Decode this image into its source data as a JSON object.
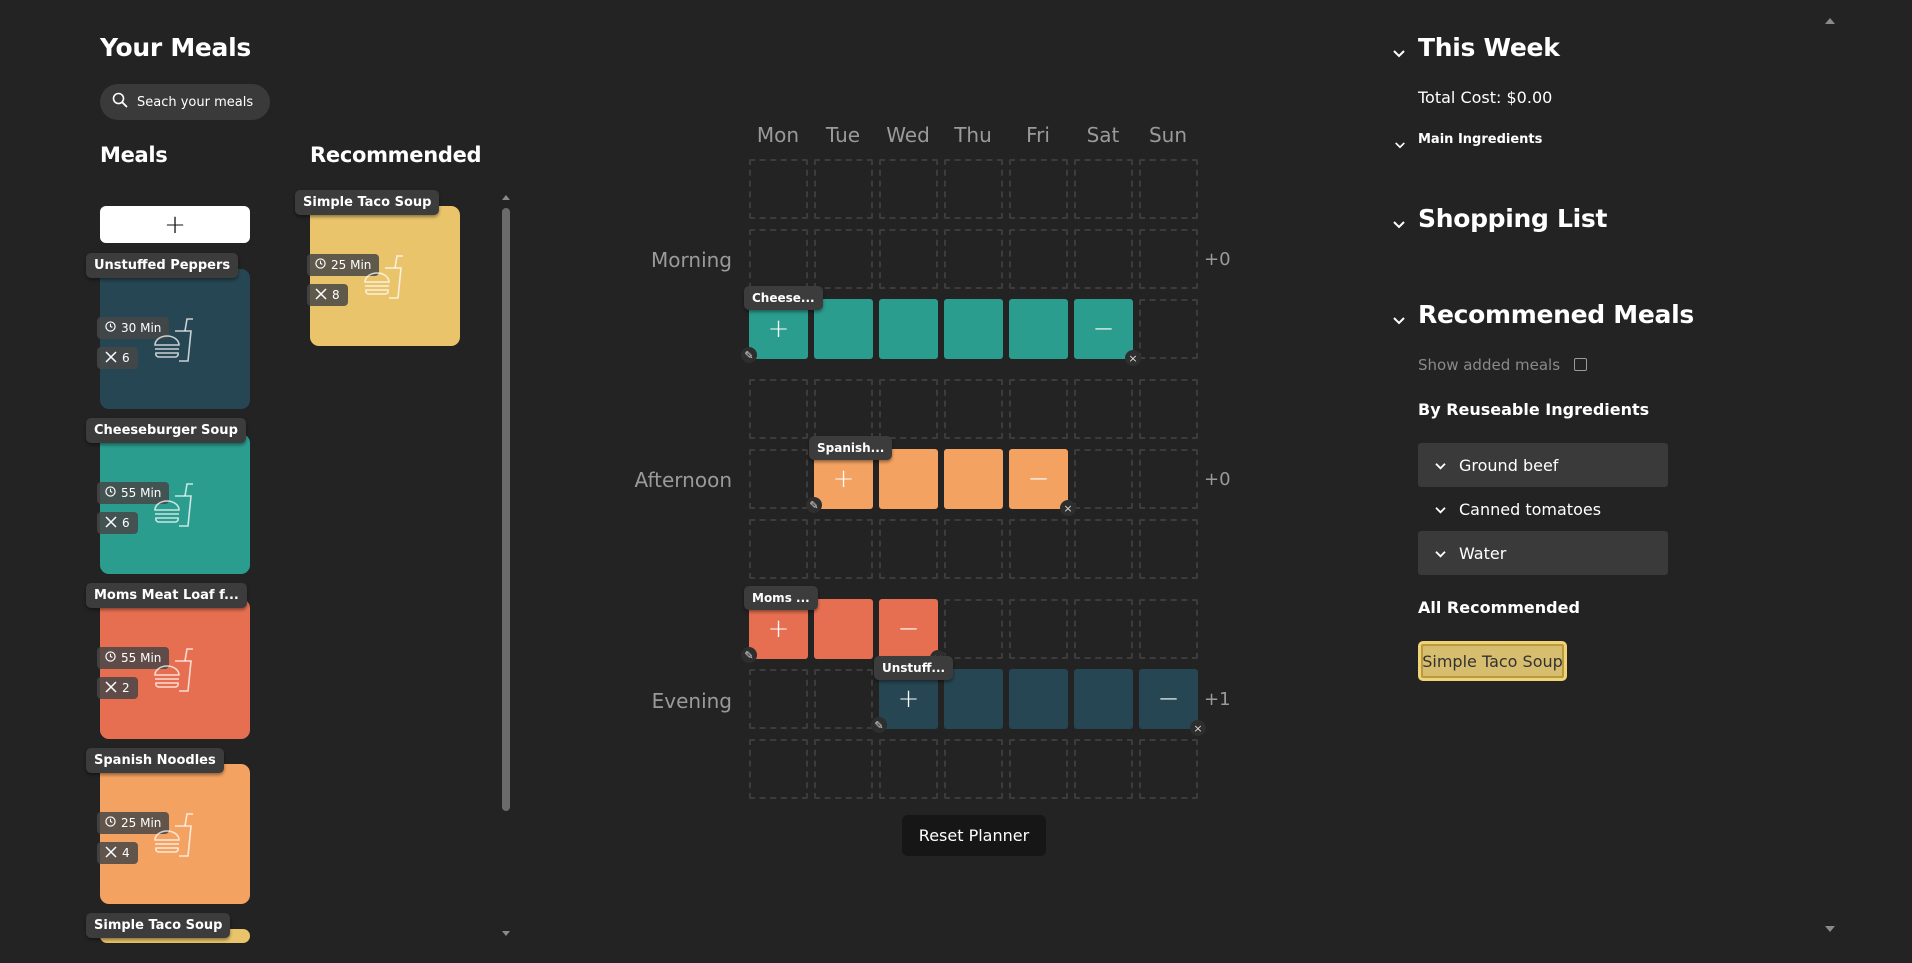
{
  "left": {
    "title": "Your Meals",
    "search_placeholder": "Seach your meals",
    "meals_heading": "Meals",
    "recommended_heading": "Recommended",
    "add_label": "+"
  },
  "meals": [
    {
      "name": "Unstuffed Peppers",
      "time": "30 Min",
      "servings": "6",
      "color": "#264653"
    },
    {
      "name": "Cheeseburger Soup",
      "time": "55 Min",
      "servings": "6",
      "color": "#2a9d8f"
    },
    {
      "name": "Moms Meat Loaf f...",
      "time": "55 Min",
      "servings": "2",
      "color": "#e76f51"
    },
    {
      "name": "Spanish Noodles",
      "time": "25 Min",
      "servings": "4",
      "color": "#f4a261"
    },
    {
      "name": "Simple Taco Soup",
      "color": "#e9c46a"
    }
  ],
  "recommended_card": {
    "name": "Simple Taco Soup",
    "time": "25 Min",
    "servings": "8",
    "color": "#e9c46a"
  },
  "planner": {
    "days": [
      "Mon",
      "Tue",
      "Wed",
      "Thu",
      "Fri",
      "Sat",
      "Sun"
    ],
    "rows": [
      {
        "label": "Morning",
        "extra": "+0"
      },
      {
        "label": "Afternoon",
        "extra": "+0"
      },
      {
        "label": "Evening",
        "extra": "+1"
      }
    ],
    "tags": {
      "morning": "Cheese...",
      "afternoon": "Spanish...",
      "evening1": "Moms ...",
      "evening2": "Unstuff..."
    },
    "plus": "+",
    "minus": "−",
    "reset_label": "Reset Planner"
  },
  "right": {
    "this_week": "This Week",
    "total_cost": "Total Cost: $0.00",
    "main_ingredients": "Main Ingredients",
    "shopping_list": "Shopping List",
    "recommended_meals": "Recommened Meals",
    "show_added": "Show added meals",
    "by_reusable": "By Reuseable Ingredients",
    "ingredients": [
      "Ground beef",
      "Canned tomatoes",
      "Water"
    ],
    "all_recommended": "All Recommended",
    "recommended_chip": "Simple Taco Soup"
  }
}
